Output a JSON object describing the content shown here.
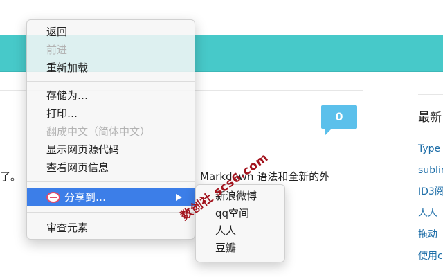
{
  "page": {
    "comment_count": "0",
    "article_text_left": "了。",
    "article_text_right": "Markdown 语法和全新的外",
    "sidebar": {
      "title": "最新",
      "links": [
        "Type",
        "sublim",
        "ID3阅",
        "人人",
        "拖动",
        "使用c"
      ]
    }
  },
  "context_menu": {
    "items": [
      {
        "label": "返回",
        "enabled": true
      },
      {
        "label": "前进",
        "enabled": false
      },
      {
        "label": "重新加载",
        "enabled": true
      },
      {
        "label": "存储为…",
        "enabled": true
      },
      {
        "label": "打印…",
        "enabled": true
      },
      {
        "label": "翻成中文（简体中文）",
        "enabled": false
      },
      {
        "label": "显示网页源代码",
        "enabled": true
      },
      {
        "label": "查看网页信息",
        "enabled": true
      },
      {
        "label": "分享到…",
        "enabled": true,
        "highlighted": true,
        "icon": "share-extension-icon"
      },
      {
        "label": "审查元素",
        "enabled": true
      }
    ],
    "highlight_color": "#3c7ee8"
  },
  "share_submenu": {
    "items": [
      "新浪微博",
      "qq空间",
      "人人",
      "豆瓣"
    ]
  },
  "watermark": {
    "text": "数创社 scs6.com"
  },
  "colors": {
    "topbar": "#47c9c9",
    "comment_bubble": "#5bc0eb",
    "link": "#1e6ea8"
  }
}
